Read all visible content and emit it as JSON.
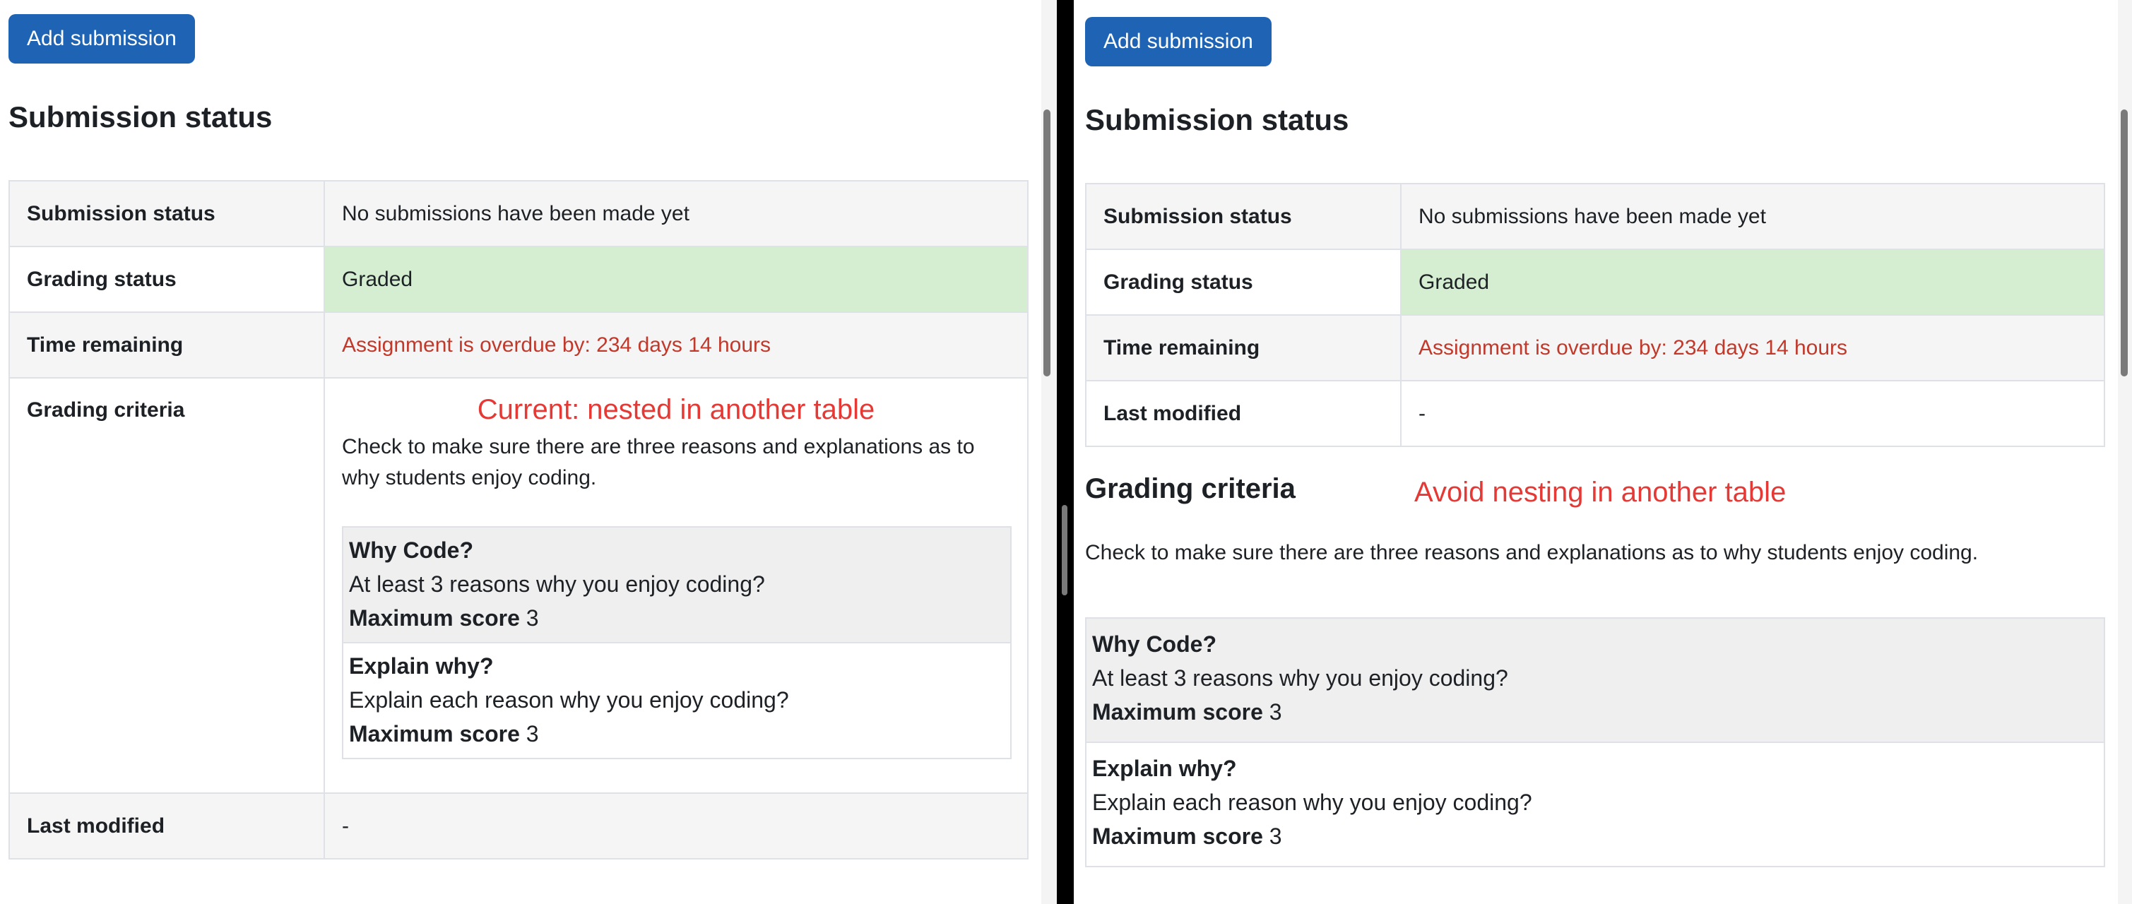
{
  "left": {
    "add_button": "Add submission",
    "heading": "Submission status",
    "rows": {
      "submission_status": {
        "label": "Submission status",
        "value": "No submissions have been made yet"
      },
      "grading_status": {
        "label": "Grading status",
        "value": "Graded"
      },
      "time_remaining": {
        "label": "Time remaining",
        "value": "Assignment is overdue by: 234 days 14 hours"
      },
      "grading_criteria": {
        "label": "Grading criteria"
      },
      "last_modified": {
        "label": "Last modified",
        "value": "-"
      }
    },
    "annotation": "Current: nested in another table",
    "criteria_description": "Check to make sure there are three reasons and explanations as to why students enjoy coding.",
    "criteria": [
      {
        "title": "Why Code?",
        "text": "At least 3 reasons why you enjoy coding?",
        "max_label": "Maximum score",
        "max_value": "3"
      },
      {
        "title": "Explain why?",
        "text": "Explain each reason why you enjoy coding?",
        "max_label": "Maximum score",
        "max_value": "3"
      }
    ]
  },
  "right": {
    "add_button": "Add submission",
    "heading": "Submission status",
    "rows": {
      "submission_status": {
        "label": "Submission status",
        "value": "No submissions have been made yet"
      },
      "grading_status": {
        "label": "Grading status",
        "value": "Graded"
      },
      "time_remaining": {
        "label": "Time remaining",
        "value": "Assignment is overdue by: 234 days 14 hours"
      },
      "last_modified": {
        "label": "Last modified",
        "value": "-"
      }
    },
    "criteria_heading": "Grading criteria",
    "annotation": "Avoid nesting in another table",
    "criteria_description": "Check to make sure there are three reasons and explanations as to why students enjoy coding.",
    "criteria": [
      {
        "title": "Why Code?",
        "text": "At least 3 reasons why you enjoy coding?",
        "max_label": "Maximum score",
        "max_value": "3"
      },
      {
        "title": "Explain why?",
        "text": "Explain each reason why you enjoy coding?",
        "max_label": "Maximum score",
        "max_value": "3"
      }
    ]
  },
  "colors": {
    "primary_button": "#1f64b4",
    "graded_bg": "#d5eed2",
    "overdue_text": "#c0392b",
    "annotation_text": "#e53935",
    "divider": "#000000"
  }
}
